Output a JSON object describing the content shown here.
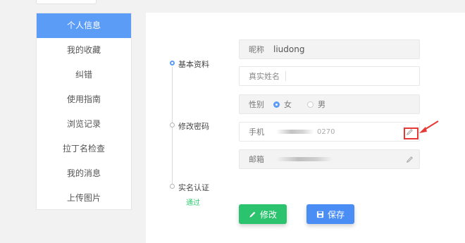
{
  "sidebar": {
    "items": [
      {
        "label": "个人信息",
        "active": true
      },
      {
        "label": "我的收藏"
      },
      {
        "label": "纠错"
      },
      {
        "label": "使用指南"
      },
      {
        "label": "浏览记录"
      },
      {
        "label": "拉丁名检查"
      },
      {
        "label": "我的消息"
      },
      {
        "label": "上传图片"
      }
    ]
  },
  "timeline": {
    "steps": [
      {
        "label": "基本资料"
      },
      {
        "label": "修改密码"
      },
      {
        "label": "实名认证",
        "status": "通过"
      }
    ]
  },
  "form": {
    "nickname_label": "昵称",
    "nickname_value": "liudong",
    "realname_placeholder": "真实姓名",
    "gender_label": "性别",
    "gender_female": "女",
    "gender_male": "男",
    "phone_label": "手机",
    "phone_value_visible": "0270",
    "email_label": "邮箱"
  },
  "buttons": {
    "edit_label": "修改",
    "save_label": "保存"
  },
  "colors": {
    "primary": "#5b9cf6",
    "green": "#2bc36d",
    "blue": "#4a8ef5",
    "annotation_red": "#e53935"
  }
}
